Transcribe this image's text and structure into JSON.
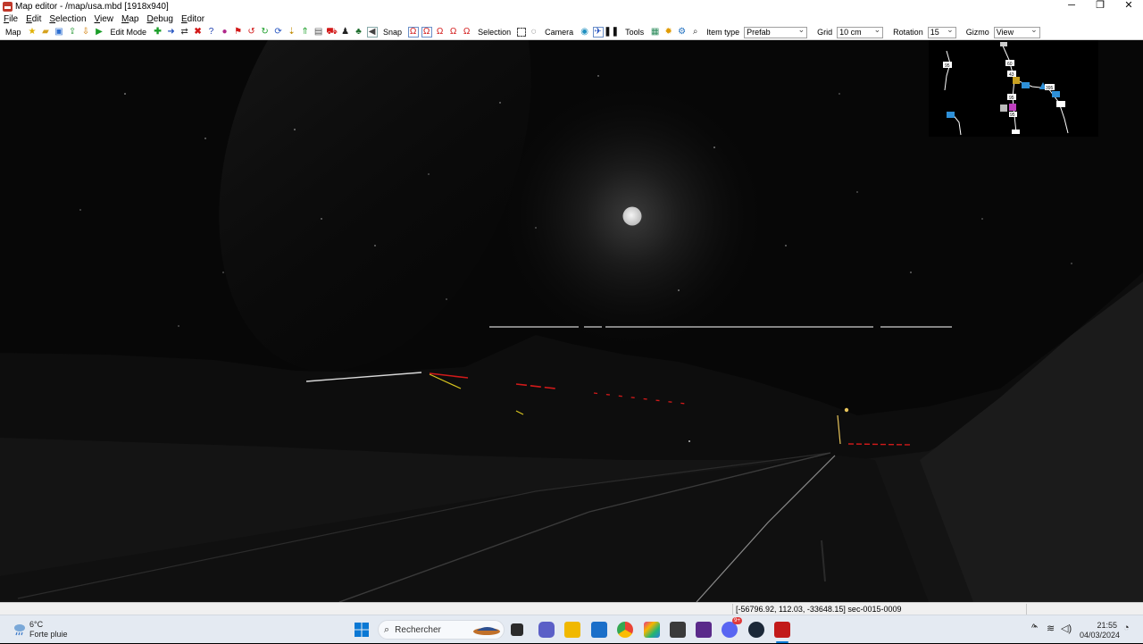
{
  "window": {
    "title": "Map editor - /map/usa.mbd [1918x940]",
    "controls": {
      "minimize": "─",
      "restore": "❐",
      "close": "✕"
    }
  },
  "menu": [
    "File",
    "Edit",
    "Selection",
    "View",
    "Map",
    "Debug",
    "Editor"
  ],
  "toolbar": {
    "map_label": "Map",
    "edit_mode_label": "Edit Mode",
    "snap_label": "Snap",
    "selection_label": "Selection",
    "camera_label": "Camera",
    "tools_label": "Tools",
    "item_type_label": "Item type",
    "item_type_value": "Prefab",
    "grid_label": "Grid",
    "grid_value": "10 cm",
    "rotation_label": "Rotation",
    "rotation_value": "15",
    "gizmo_label": "Gizmo",
    "gizmo_value": "View"
  },
  "viewport": {
    "scene": "night-road",
    "minimap": {
      "labels": [
        "95",
        "60",
        "43",
        "395",
        "95",
        "95"
      ]
    }
  },
  "status": {
    "coords": "[-56796.92, 112.03, -33648.15] sec-0015-0009"
  },
  "taskbar": {
    "weather_temp": "6°C",
    "weather_desc": "Forte pluie",
    "search_placeholder": "Rechercher",
    "time": "21:55",
    "date": "04/03/2024",
    "apps": [
      "start-icon",
      "search-icon",
      "task-view-icon",
      "teams-icon",
      "file-explorer-icon",
      "store-icon",
      "chrome-icon",
      "photos-icon",
      "editor-icon",
      "app-icon",
      "discord-icon",
      "steam-icon",
      "truck-icon"
    ],
    "discord_badge": "9+"
  },
  "colors": {
    "accent": "#0067c0",
    "road_line": "#cfcfcf",
    "tail_light": "#d11a1a",
    "street_lamp": "#e6c35a"
  }
}
